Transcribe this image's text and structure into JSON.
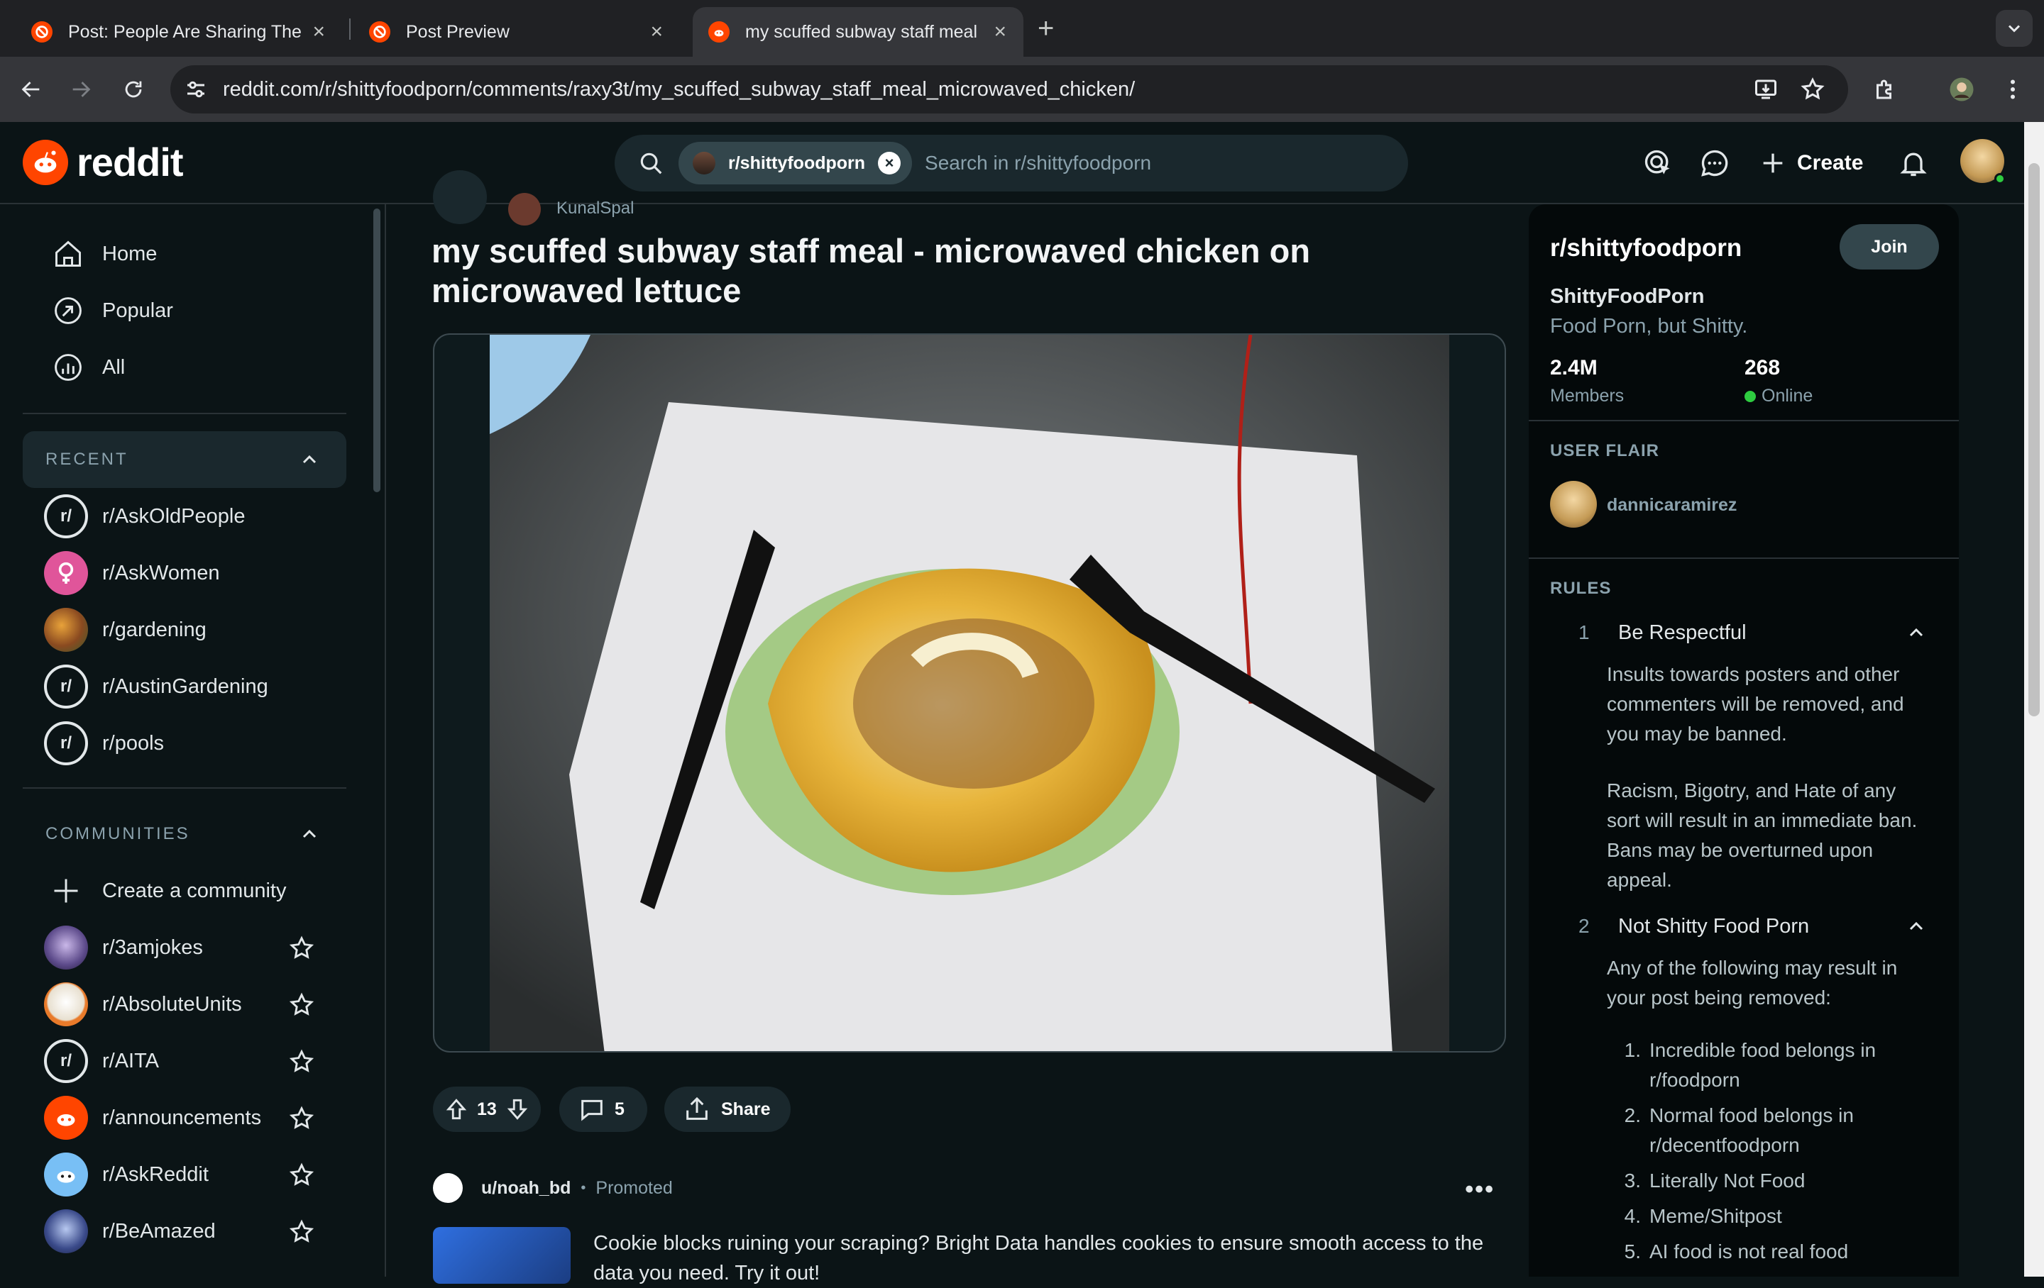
{
  "browser": {
    "tabs": [
      {
        "title": "Post: People Are Sharing The"
      },
      {
        "title": "Post Preview"
      },
      {
        "title": "my scuffed subway staff meal"
      }
    ],
    "url": "reddit.com/r/shittyfoodporn/comments/raxy3t/my_scuffed_subway_staff_meal_microwaved_chicken/"
  },
  "header": {
    "logo_text": "reddit",
    "search_chip": "r/shittyfoodporn",
    "search_placeholder": "Search in r/shittyfoodporn",
    "create_label": "Create"
  },
  "sidebar": {
    "nav": [
      {
        "label": "Home"
      },
      {
        "label": "Popular"
      },
      {
        "label": "All"
      }
    ],
    "recent_heading": "RECENT",
    "recent": [
      {
        "label": "r/AskOldPeople"
      },
      {
        "label": "r/AskWomen"
      },
      {
        "label": "r/gardening"
      },
      {
        "label": "r/AustinGardening"
      },
      {
        "label": "r/pools"
      }
    ],
    "communities_heading": "COMMUNITIES",
    "create_community": "Create a community",
    "communities": [
      {
        "label": "r/3amjokes"
      },
      {
        "label": "r/AbsoluteUnits"
      },
      {
        "label": "r/AITA"
      },
      {
        "label": "r/announcements"
      },
      {
        "label": "r/AskReddit"
      },
      {
        "label": "r/BeAmazed"
      }
    ]
  },
  "post": {
    "author": "KunalSpal",
    "title": "my scuffed subway staff meal - microwaved chicken on microwaved lettuce",
    "votes": "13",
    "comments": "5",
    "share_label": "Share"
  },
  "promo": {
    "user": "u/noah_bd",
    "tag": "Promoted",
    "text": "Cookie blocks ruining your scraping? Bright Data handles cookies to ensure smooth access to the data you need. Try it out!"
  },
  "subreddit": {
    "name": "r/shittyfoodporn",
    "join_label": "Join",
    "title": "ShittyFoodPorn",
    "description": "Food Porn, but Shitty.",
    "members_value": "2.4M",
    "members_label": "Members",
    "online_value": "268",
    "online_label": "Online",
    "user_flair_heading": "USER FLAIR",
    "flair_user": "dannicaramirez",
    "rules_heading": "RULES",
    "rules": [
      {
        "num": "1",
        "title": "Be Respectful",
        "body_1": "Insults towards posters and other commenters will be removed, and you may be banned.",
        "body_2": "Racism, Bigotry, and Hate of any sort will result in an immediate ban. Bans may be overturned upon appeal."
      },
      {
        "num": "2",
        "title": "Not Shitty Food Porn",
        "body_1": "Any of the following may result in your post being removed:",
        "list": [
          {
            "n": "1.",
            "t": "Incredible food belongs in r/foodporn"
          },
          {
            "n": "2.",
            "t": "Normal food belongs in r/decentfoodporn"
          },
          {
            "n": "3.",
            "t": "Literally Not Food"
          },
          {
            "n": "4.",
            "t": "Meme/Shitpost"
          },
          {
            "n": "5.",
            "t": "AI food is not real food"
          }
        ]
      }
    ]
  },
  "colors": {
    "accent": "#ff4500",
    "bg": "#0b1416",
    "chip": "#33464c",
    "online": "#2ecc40"
  }
}
